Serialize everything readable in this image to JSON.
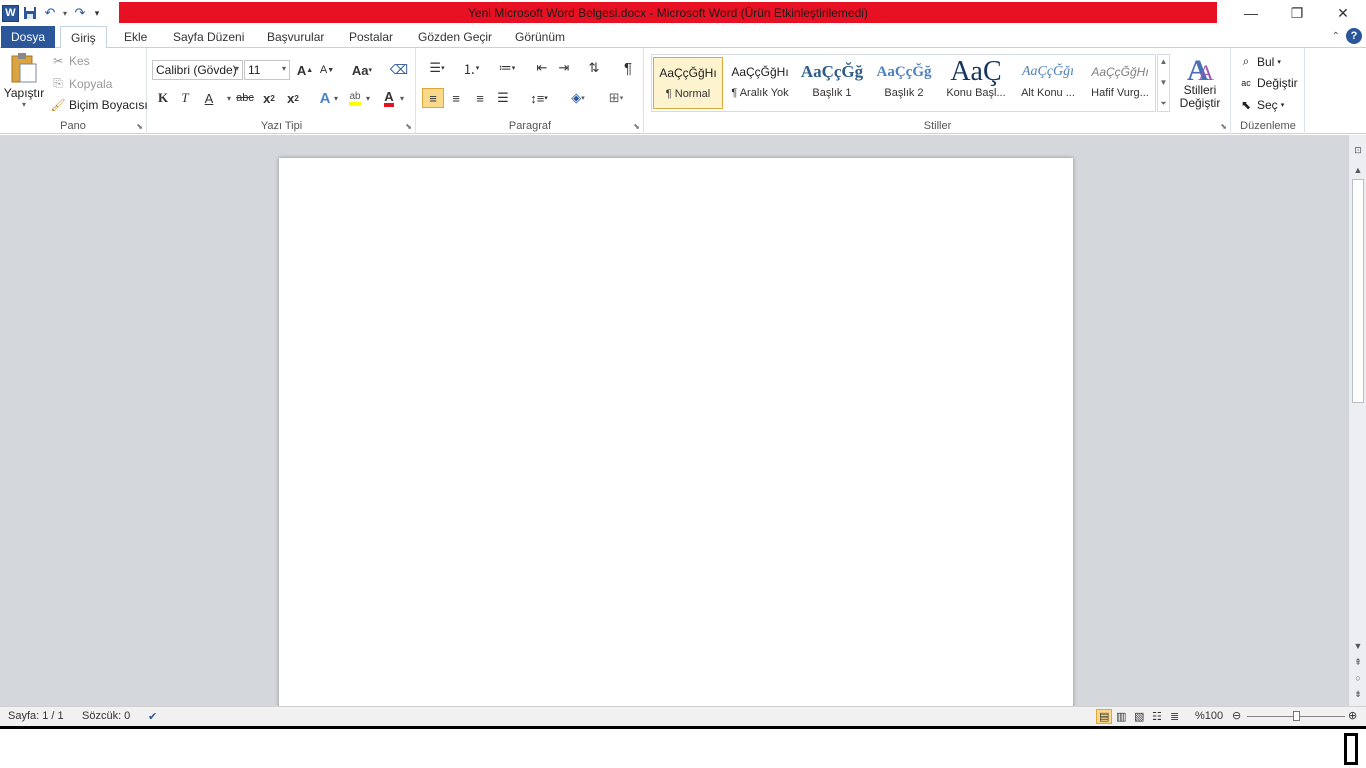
{
  "titlebar": {
    "title": "Yeni Microsoft Word Belgesi.docx  -  Microsoft Word (Ürün Etkinleştirilemedi)",
    "app_icon_letter": "W",
    "accent_color": "#e81123"
  },
  "tabs": {
    "file": "Dosya",
    "items": [
      "Giriş",
      "Ekle",
      "Sayfa Düzeni",
      "Başvurular",
      "Postalar",
      "Gözden Geçir",
      "Görünüm"
    ],
    "help": "?"
  },
  "clipboard": {
    "paste": "Yapıştır",
    "cut": "Kes",
    "copy": "Kopyala",
    "format_painter": "Biçim Boyacısı",
    "label": "Pano"
  },
  "font": {
    "font_name": "Calibri (Gövde)",
    "font_size": "11",
    "label": "Yazı Tipi",
    "bold": "K",
    "italic": "T",
    "underline": "A",
    "strike": "abc",
    "change_case": "Aa"
  },
  "paragraph": {
    "label": "Paragraf"
  },
  "styles": {
    "label": "Stiller",
    "tiles": [
      {
        "preview": "AaÇçĞğHı",
        "name": "¶ Normal"
      },
      {
        "preview": "AaÇçĞğHı",
        "name": "¶ Aralık Yok"
      },
      {
        "preview": "AaÇçĞğ",
        "name": "Başlık 1"
      },
      {
        "preview": "AaÇçĞğ",
        "name": "Başlık 2"
      },
      {
        "preview": "AaÇ",
        "name": "Konu Başl..."
      },
      {
        "preview": "AaÇçĞğı",
        "name": "Alt Konu ..."
      },
      {
        "preview": "AaÇçĞğHı",
        "name": "Hafif Vurg..."
      }
    ],
    "change_styles_1": "Stilleri",
    "change_styles_2": "Değiştir"
  },
  "editing": {
    "label": "Düzenleme",
    "find": "Bul",
    "replace": "Değiştir",
    "select": "Seç"
  },
  "status": {
    "page": "Sayfa: 1 / 1",
    "words": "Sözcük: 0",
    "zoom": "%100"
  }
}
